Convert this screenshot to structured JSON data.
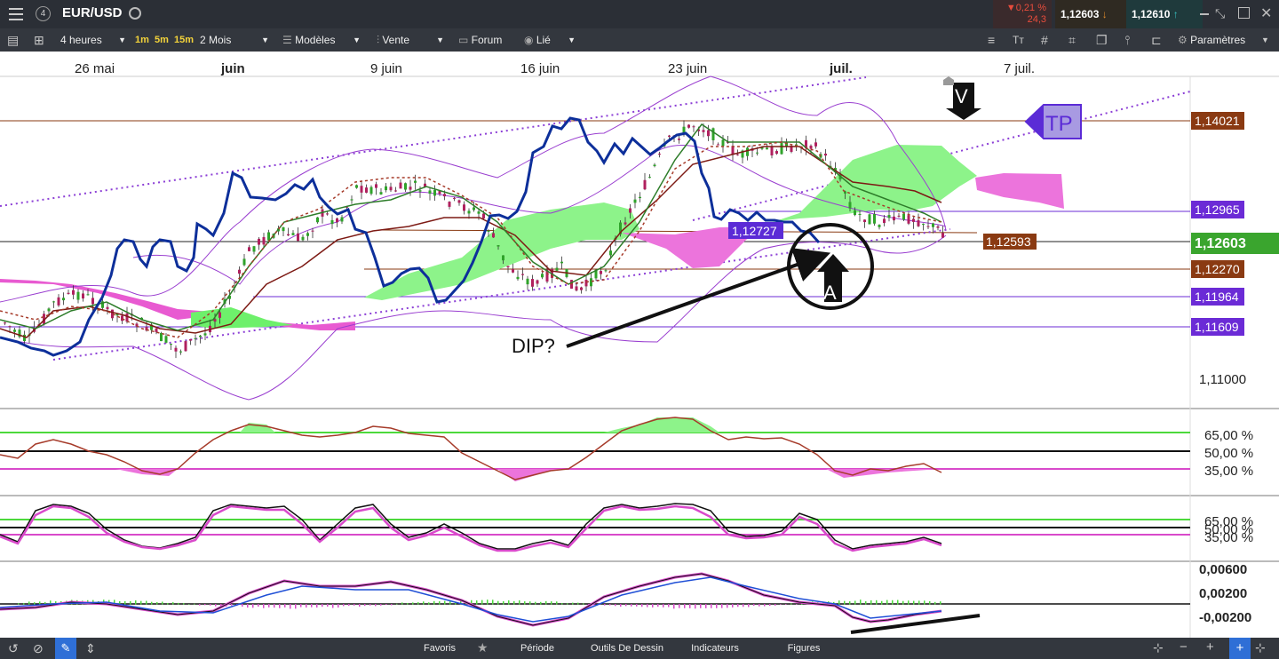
{
  "topbar": {
    "tab_badge": "4",
    "symbol": "EUR/USD",
    "change_pct": "▼0,21 %",
    "change_pts": "24,3",
    "bid": "1,12603",
    "ask": "1,12610"
  },
  "toolbar": {
    "timeframe": "4 heures",
    "tf_1m": "1m",
    "tf_5m": "5m",
    "tf_15m": "15m",
    "range": "2 Mois",
    "models": "Modèles",
    "sell": "Vente",
    "forum": "Forum",
    "linked": "Lié",
    "settings": "Paramètres"
  },
  "bottombar": {
    "favorites": "Favoris",
    "period": "Période",
    "drawing_tools": "Outils De Dessin",
    "indicators": "Indicateurs",
    "figures": "Figures"
  },
  "chart_data": {
    "type": "line",
    "instrument": "EUR/USD",
    "timeframe": "4 heures",
    "x_ticks": [
      "26 mai",
      "juin",
      "9 juin",
      "16 juin",
      "23 juin",
      "juil.",
      "7 juil."
    ],
    "main_pane": {
      "y_ticks": [
        "1,11000"
      ],
      "price_tags": [
        {
          "label": "1,14021",
          "color": "#8a3a12"
        },
        {
          "label": "1,12965",
          "color": "#6b2bd6"
        },
        {
          "label": "1,12603",
          "color": "#3aa52e"
        },
        {
          "label": "1,12270",
          "color": "#8a3a12"
        },
        {
          "label": "1,11964",
          "color": "#6b2bd6"
        },
        {
          "label": "1,11609",
          "color": "#6b2bd6"
        }
      ],
      "inline_tags": [
        {
          "label": "1,12727",
          "color": "#5b2bd6"
        },
        {
          "label": "1,12593",
          "color": "#8a3a12"
        }
      ],
      "annotations": [
        "DIP?",
        "A",
        "V",
        "TP"
      ]
    },
    "rsi_pane": {
      "y_ticks": [
        "65,00 %",
        "50,00 %",
        "35,00 %"
      ],
      "levels": [
        65,
        50,
        35
      ]
    },
    "stoch_pane": {
      "y_ticks": [
        "65,00 %",
        "50,00 %",
        "35,00 %"
      ],
      "levels": [
        65,
        50,
        35
      ]
    },
    "macd_pane": {
      "y_ticks": [
        "0,00600",
        "0,00200",
        "-0,00200"
      ]
    }
  }
}
